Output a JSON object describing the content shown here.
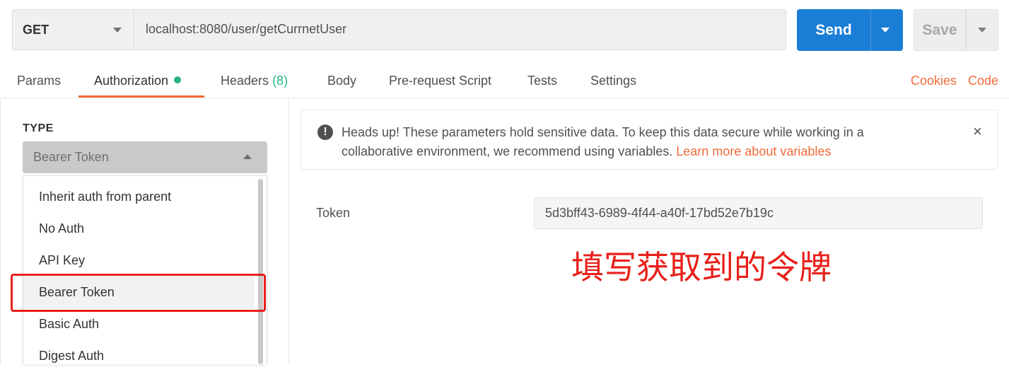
{
  "request": {
    "method": "GET",
    "url": "localhost:8080/user/getCurrnetUser",
    "send_label": "Send",
    "save_label": "Save"
  },
  "tabs": {
    "params": "Params",
    "authorization": "Authorization",
    "headers": "Headers",
    "headers_count": "(8)",
    "body": "Body",
    "prerequest": "Pre-request Script",
    "tests": "Tests",
    "settings": "Settings",
    "cookies": "Cookies",
    "code": "Code"
  },
  "auth": {
    "type_label": "TYPE",
    "selected_type": "Bearer Token",
    "options": [
      "Inherit auth from parent",
      "No Auth",
      "API Key",
      "Bearer Token",
      "Basic Auth",
      "Digest Auth"
    ]
  },
  "alert": {
    "text": "Heads up! These parameters hold sensitive data. To keep this data secure while working in a collaborative environment, we recommend using variables.",
    "link": "Learn more about variables",
    "close": "×"
  },
  "token": {
    "label": "Token",
    "value": "5d3bff43-6989-4f44-a40f-17bd52e7b19c"
  },
  "annotation": "填写获取到的令牌",
  "colors": {
    "accent_blue": "#1a7ed6",
    "accent_orange": "#f26b3a",
    "status_green": "#26b47f",
    "annotation_red": "#e8201a"
  }
}
